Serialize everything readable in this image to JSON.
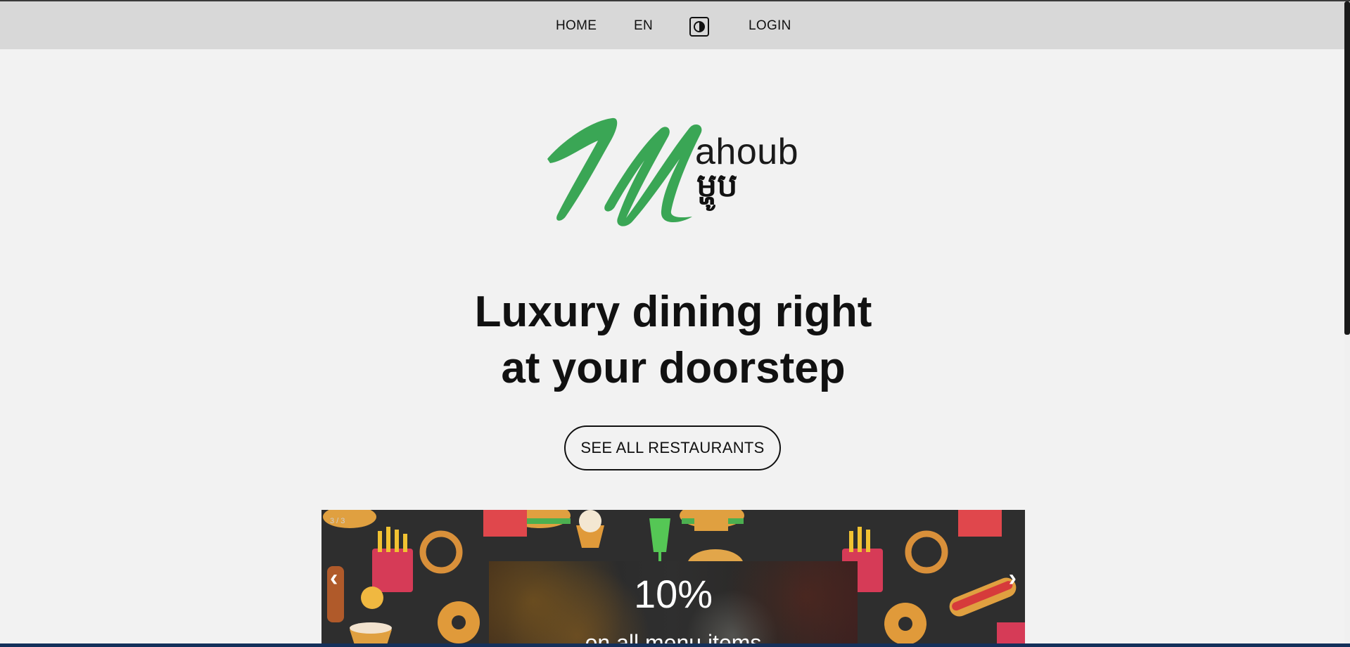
{
  "nav": {
    "home": "HOME",
    "language": "EN",
    "contrast_icon": "contrast-toggle-icon",
    "login": "LOGIN"
  },
  "logo": {
    "mark": "M",
    "name_en": "ahoub",
    "name_km": "ម្ហូប",
    "color": "#3aa655"
  },
  "hero": {
    "headline_line1": "Luxury dining right",
    "headline_line2": "at your doorstep",
    "cta": "SEE ALL RESTAURANTS"
  },
  "banner": {
    "slide_counter": "3 / 3",
    "promo_value": "10%",
    "promo_text": "on all menu items",
    "prev_icon": "chevron-left-icon",
    "next_icon": "chevron-right-icon"
  }
}
